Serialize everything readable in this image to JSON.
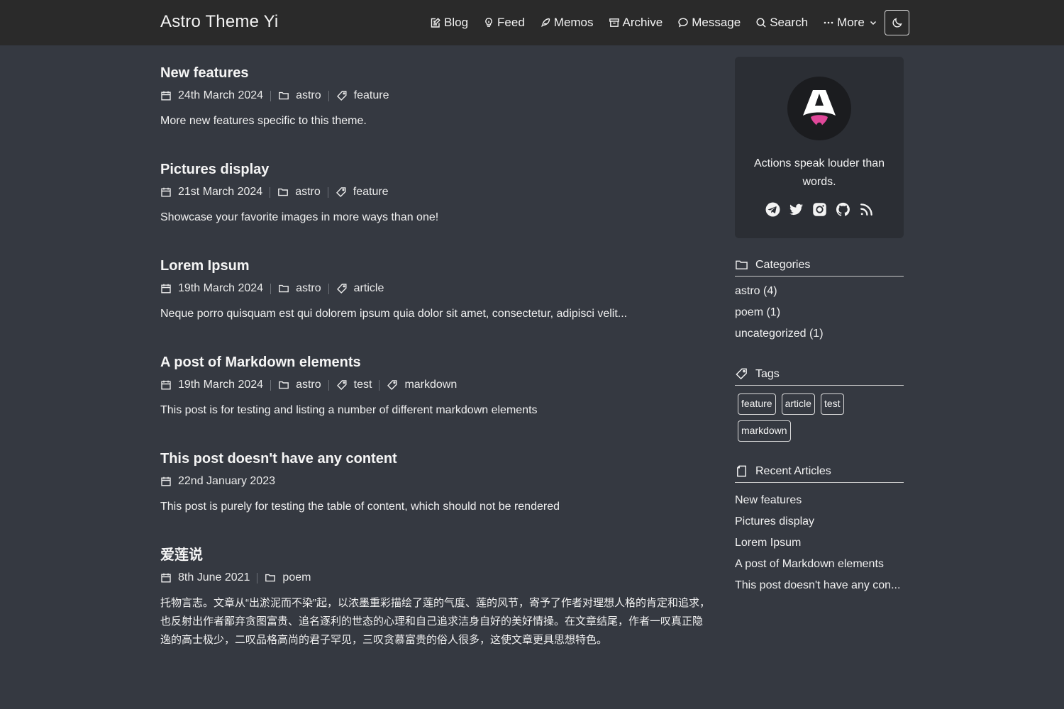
{
  "header": {
    "brand": "Astro Theme Yi",
    "nav": [
      {
        "label": "Blog",
        "icon": "blog-edit-icon"
      },
      {
        "label": "Feed",
        "icon": "lightbulb-icon"
      },
      {
        "label": "Memos",
        "icon": "feather-icon"
      },
      {
        "label": "Archive",
        "icon": "archive-box-icon"
      },
      {
        "label": "Message",
        "icon": "chat-bubble-icon"
      },
      {
        "label": "Search",
        "icon": "search-icon"
      },
      {
        "label": "More",
        "icon": "ellipsis-icon"
      }
    ],
    "theme_toggle_icon": "moon-icon"
  },
  "posts": [
    {
      "title": "New features",
      "date": "24th March 2024",
      "category": "astro",
      "tags": [
        "feature"
      ],
      "excerpt": "More new features specific to this theme."
    },
    {
      "title": "Pictures display",
      "date": "21st March 2024",
      "category": "astro",
      "tags": [
        "feature"
      ],
      "excerpt": "Showcase your favorite images in more ways than one!"
    },
    {
      "title": "Lorem Ipsum",
      "date": "19th March 2024",
      "category": "astro",
      "tags": [
        "article"
      ],
      "excerpt": "Neque porro quisquam est qui dolorem ipsum quia dolor sit amet, consectetur, adipisci velit..."
    },
    {
      "title": "A post of Markdown elements",
      "date": "19th March 2024",
      "category": "astro",
      "tags": [
        "test",
        "markdown"
      ],
      "excerpt": "This post is for testing and listing a number of different markdown elements"
    },
    {
      "title": "This post doesn't have any content",
      "date": "22nd January 2023",
      "category": "",
      "tags": [],
      "excerpt": "This post is purely for testing the table of content, which should not be rendered"
    },
    {
      "title": "爱莲说",
      "date": "8th June 2021",
      "category": "poem",
      "tags": [],
      "excerpt": "托物言志。文章从“出淤泥而不染”起，以浓墨重彩描绘了莲的气度、莲的风节，寄予了作者对理想人格的肯定和追求，也反射出作者鄙弃贪图富贵、追名逐利的世态的心理和自己追求洁身自好的美好情操。在文章结尾，作者一叹真正隐逸的高士极少，二叹品格高尚的君子罕见，三叹贪慕富贵的俗人很多，这使文章更具思想特色。"
    }
  ],
  "sidebar": {
    "profile": {
      "motto": "Actions speak louder than words.",
      "socials": [
        "telegram-icon",
        "twitter-icon",
        "instagram-icon",
        "github-icon",
        "rss-icon"
      ]
    },
    "categories": {
      "title": "Categories",
      "items": [
        "astro (4)",
        "poem (1)",
        "uncategorized (1)"
      ]
    },
    "tags": {
      "title": "Tags",
      "items": [
        "feature",
        "article",
        "test",
        "markdown"
      ]
    },
    "recent": {
      "title": "Recent Articles",
      "items": [
        "New features",
        "Pictures display",
        "Lorem Ipsum",
        "A post of Markdown elements",
        "This post doesn't have any con..."
      ]
    }
  },
  "colors": {
    "page_bg": "#353941",
    "header_bg": "#2a2a2a",
    "card_bg": "#2b2e34",
    "logo_pink": "#e0489a"
  }
}
